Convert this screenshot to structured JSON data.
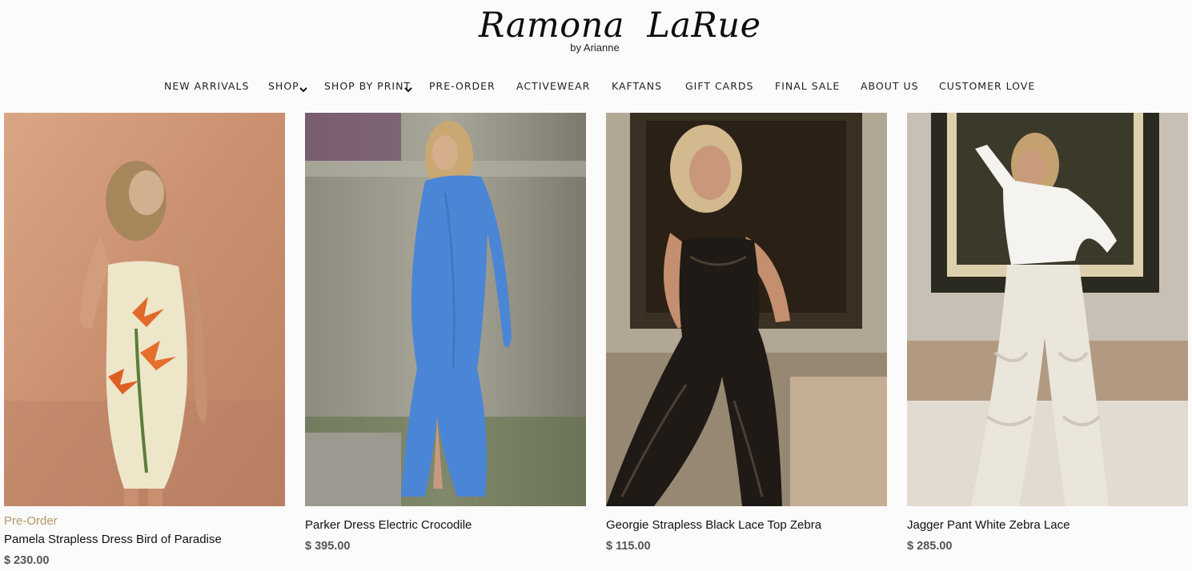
{
  "brand": {
    "name": "Ramona  LaRue",
    "tagline": "by Arianne"
  },
  "nav": {
    "items": [
      {
        "label": "NEW ARRIVALS",
        "has_dropdown": false
      },
      {
        "label": "SHOP",
        "has_dropdown": true
      },
      {
        "label": "SHOP BY PRINT",
        "has_dropdown": true
      },
      {
        "label": "PRE-ORDER",
        "has_dropdown": false
      },
      {
        "label": "ACTIVEWEAR",
        "has_dropdown": false
      },
      {
        "label": "KAFTANS",
        "has_dropdown": false
      },
      {
        "label": "GIFT CARDS",
        "has_dropdown": false
      },
      {
        "label": "FINAL SALE",
        "has_dropdown": false
      },
      {
        "label": "ABOUT US",
        "has_dropdown": false
      },
      {
        "label": "CUSTOMER LOVE",
        "has_dropdown": false
      }
    ]
  },
  "products": [
    {
      "badge": "Pre-Order",
      "title": "Pamela Strapless Dress Bird of Paradise",
      "price": "$ 230.00"
    },
    {
      "badge": "",
      "title": "Parker Dress Electric Crocodile",
      "price": "$ 395.00"
    },
    {
      "badge": "",
      "title": "Georgie Strapless Black Lace Top Zebra",
      "price": "$ 115.00"
    },
    {
      "badge": "",
      "title": "Jagger Pant White Zebra Lace",
      "price": "$ 285.00"
    }
  ],
  "colors": {
    "badge": "#b0976a",
    "price": "#555555",
    "text": "#111111"
  }
}
